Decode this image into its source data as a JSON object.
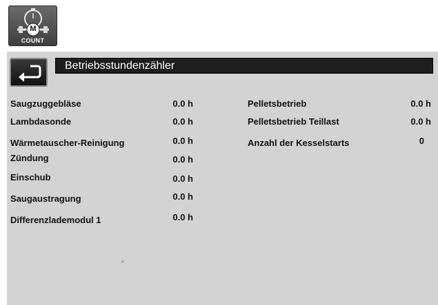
{
  "app_icon": {
    "badge_letter": "M",
    "label": "COUNT"
  },
  "header": {
    "title": "Betriebsstundenzähler"
  },
  "left_column": [
    {
      "label": "Saugzuggebläse",
      "value": "0.0 h"
    },
    {
      "label": "Lambdasonde",
      "value": "0.0 h"
    },
    {
      "label": "Wärmetauscher-Reinigung",
      "value": "0.0 h"
    },
    {
      "label": "Zündung",
      "value": "0.0 h"
    },
    {
      "label": "Einschub",
      "value": "0.0 h"
    },
    {
      "label": "Saugaustragung",
      "value": "0.0 h"
    },
    {
      "label": "Differenzlademodul 1",
      "value": "0.0 h"
    }
  ],
  "right_column": [
    {
      "label": "Pelletsbetrieb",
      "value": "0.0 h"
    },
    {
      "label": "Pelletsbetrieb Teillast",
      "value": "0.0 h"
    },
    {
      "label": "Anzahl der Kesselstarts",
      "value": "0"
    }
  ]
}
